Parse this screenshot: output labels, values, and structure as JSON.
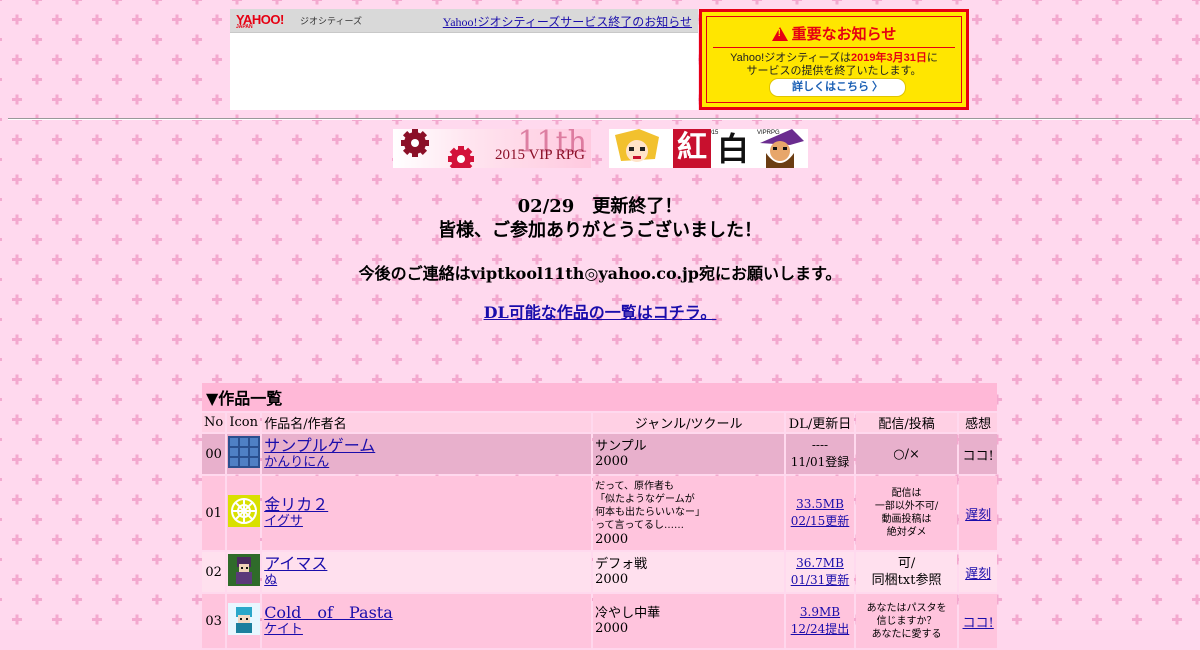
{
  "yahoo_bar": {
    "logo": "YAHOO!",
    "logo_sub": "JAPAN",
    "geo_label": "ジオシティーズ",
    "end_link": "Yahoo!ジオシティーズサービス終了のお知らせ"
  },
  "notice": {
    "title": "重要なお知らせ",
    "line1_pre": "Yahoo!ジオシティーズは",
    "line1_date": "2019年3月31日",
    "line1_post": "に",
    "line2": "サービスの提供を終了いたします。",
    "button": "詳しくはこちら 〉"
  },
  "banners": {
    "b1_big": "11th",
    "b1_sub": "2015 VIP RPG",
    "b2_left": "紅",
    "b2_right": "白",
    "b2_tag": "2015",
    "b2_tag2": "VIPRPG"
  },
  "main": {
    "line1": "02/29　更新終了！",
    "line2": "皆様、ご参加ありがとうございました！",
    "line3": "今後のご連絡はviptkool11th◎yahoo.co.jp宛にお願いします。",
    "link": "DL可能な作品の一覧はコチラ。"
  },
  "table": {
    "title": "▼作品一覧",
    "headers": [
      "No",
      "Icon",
      "作品名/作者名",
      "ジャンル/ツクール",
      "DL/更新日",
      "配信/投稿",
      "感想"
    ],
    "rows": [
      {
        "no": "00",
        "icon": "blue-grid-icon",
        "game": "サンプルゲーム",
        "author": "かんりにん",
        "genre": "サンプル",
        "tool": "2000",
        "dl1": "----",
        "dl2": "11/01登録",
        "dist": "○/×",
        "imp": "ココ!"
      },
      {
        "no": "01",
        "icon": "yellow-flower-icon",
        "game": "金リカ２",
        "author": "イグサ",
        "genre": "だって、原作者も",
        "genre2": "「似たようなゲームが",
        "genre3": "何本も出たらいいなー」",
        "genre4": "って言ってるし……",
        "tool": "2000",
        "dl1": "33.5MB",
        "dl2": "02/15更新",
        "dist1": "配信は",
        "dist2": "一部以外不可/",
        "dist3": "動画投稿は",
        "dist4": "絶対ダメ",
        "imp": "遅刻"
      },
      {
        "no": "02",
        "icon": "character-icon",
        "game": "アイマス",
        "author": "ぬ",
        "genre": "デフォ戦",
        "tool": "2000",
        "dl1": "36.7MB",
        "dl2": "01/31更新",
        "dist1": "可/",
        "dist2": "同梱txt参照",
        "imp": "遅刻"
      },
      {
        "no": "03",
        "icon": "pixel-char-icon",
        "game": "Cold　of　Pasta",
        "author": "ケイト",
        "genre": "冷やし中華",
        "tool": "2000",
        "dl1": "3.9MB",
        "dl2": "12/24提出",
        "dist1": "あなたはパスタを",
        "dist2": "信じますか？",
        "dist3": "あなたに愛する",
        "imp": "ココ!"
      }
    ]
  },
  "colors": {
    "background": "#ffd6ec",
    "link": "#1a0dab",
    "alert": "#e60012"
  }
}
